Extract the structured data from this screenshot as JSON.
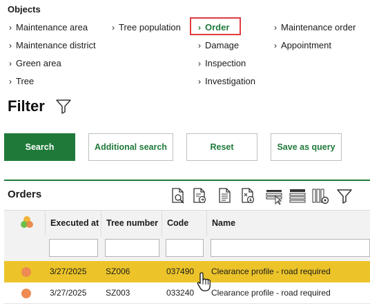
{
  "objects": {
    "title": "Objects",
    "links": [
      {
        "label": "Maintenance area"
      },
      {
        "label": "Maintenance district"
      },
      {
        "label": "Green area"
      },
      {
        "label": "Tree"
      },
      {
        "label": "Tree population"
      },
      {
        "label": "Order"
      },
      {
        "label": "Damage"
      },
      {
        "label": "Inspection"
      },
      {
        "label": "Investigation"
      },
      {
        "label": "Maintenance order"
      },
      {
        "label": "Appointment"
      }
    ],
    "active": "Order"
  },
  "filter": {
    "title": "Filter",
    "buttons": {
      "search": "Search",
      "additional_search": "Additional search",
      "reset": "Reset",
      "save_as_query": "Save as query"
    }
  },
  "orders": {
    "title": "Orders",
    "columns": [
      "Executed at",
      "Tree number",
      "Code",
      "Name"
    ],
    "rows": [
      {
        "executed_at": "3/27/2025",
        "tree_number": "SZ006",
        "code": "037490",
        "name": "Clearance profile - road required",
        "selected": true
      },
      {
        "executed_at": "3/27/2025",
        "tree_number": "SZ003",
        "code": "033240",
        "name": "Clearance profile - road required",
        "selected": false
      }
    ]
  },
  "colors": {
    "accent": "#1f7a3a",
    "highlight_box": "#e03a3e",
    "selected_row": "#ecc42a",
    "status_dot": "#ee8a52"
  },
  "icons": [
    "chevron-right-icon",
    "filter-funnel-icon",
    "document-search-icon",
    "document-export-icon",
    "document-icon",
    "document-download-icon",
    "select-rows-icon",
    "list-rows-icon",
    "column-settings-icon",
    "funnel-icon",
    "status-dots-icon",
    "hand-cursor-icon"
  ]
}
